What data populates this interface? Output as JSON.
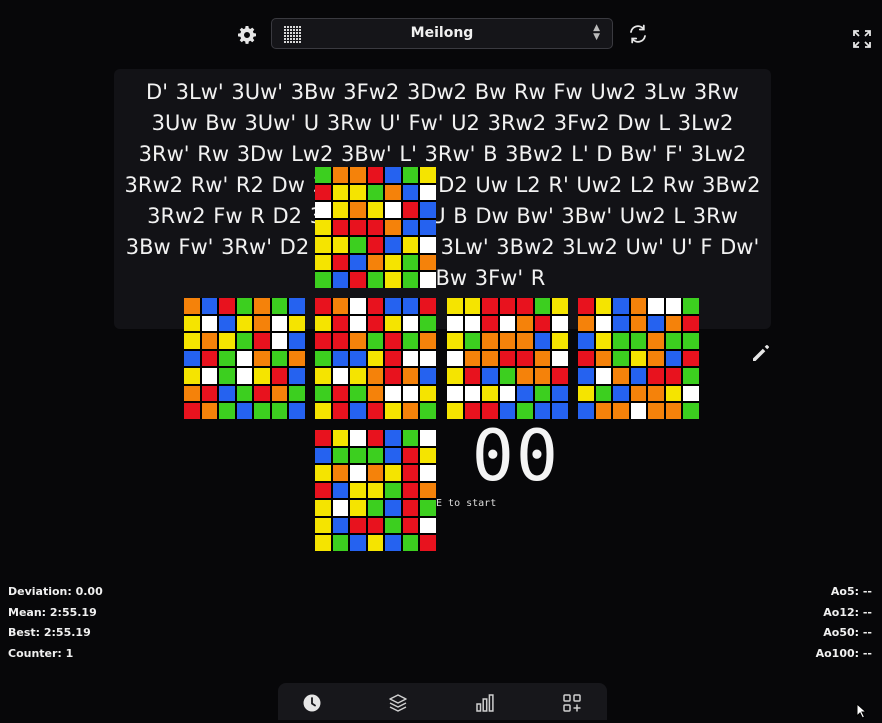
{
  "header": {
    "settings_icon": "gear-icon",
    "puzzle_select": {
      "value": "Meilong",
      "icon": "cube-grid-icon"
    },
    "refresh_icon": "refresh-icon",
    "fullscreen_icon": "fullscreen-icon"
  },
  "scramble": {
    "text": "D' 3Lw' 3Uw' 3Bw 3Fw2 3Dw2 Bw Rw Fw Uw2 3Lw 3Rw 3Uw Bw 3Uw' U 3Rw U' Fw' U2 3Rw2 3Fw2 Dw L 3Lw2 3Rw' Rw 3Dw Lw2 3Bw' L' 3Rw' B 3Bw2 L' D Bw' F' 3Lw2 3Rw2 Rw' R2 Dw 3Lw2 D2 L' D2 Uw L2 R' Uw2 L2 Rw 3Bw2 3Rw2 Fw R D2 3Uw2 Uw2 U B Dw Bw' 3Bw' Uw2 L 3Rw 3Bw Fw' 3Rw' D2 Bw2 L' Uw' 3Lw' 3Bw2 3Lw2 Uw' U' F Dw' Lw' Uw2 Bw 3Fw' R"
  },
  "timer": {
    "display": "00",
    "hint": "CE to start"
  },
  "stats_left": {
    "deviation": "Deviation: 0.00",
    "mean": "Mean: 2:55.19",
    "best": "Best: 2:55.19",
    "counter": "Counter: 1"
  },
  "stats_right": {
    "ao5": "Ao5: --",
    "ao12": "Ao12: --",
    "ao50": "Ao50: --",
    "ao100": "Ao100: --"
  },
  "bottom_nav": [
    "clock-icon",
    "layers-icon",
    "bar-chart-icon",
    "add-widget-icon"
  ],
  "colors": {
    "W": "#ffffff",
    "Y": "#f5e400",
    "R": "#e8121e",
    "O": "#f5820a",
    "G": "#3ccf1f",
    "B": "#2562f0"
  },
  "cube_net": {
    "U": [
      "GOORBGY",
      "RYYGOBW",
      "WYOYWRB",
      "YRRROBB",
      "YYGRBYW",
      "YRBOYGO",
      "GBRGYGW"
    ],
    "L": [
      "OBRGOGB",
      "YWBYOWY",
      "YOYGRWB",
      "BRGWOGO",
      "YWGWYRB",
      "ORBGROG",
      "ROGBGGB"
    ],
    "F": [
      "ROWRBBR",
      "YRWRYWG",
      "RROGRGO",
      "GBBYRWW",
      "YWYOROB",
      "GRGOWWY",
      "YRBRYOG"
    ],
    "R": [
      "YYRRRGY",
      "WWRWORW",
      "YGOOOBY",
      "WOORROW",
      "YRBGOOR",
      "WWYWBGB",
      "YRRBGBB"
    ],
    "B": [
      "RYBOWWG",
      "OWBOBOR",
      "BYGGOGG",
      "ROGYOBR",
      "BWOBRRG",
      "YGBOOYW",
      "BOOWOOG"
    ],
    "D": [
      "RYWRBGW",
      "BGGGBRY",
      "YOWOYRW",
      "RBYYGRO",
      "YWYGBRG",
      "YBRRGRW",
      "YGBYBGR"
    ]
  }
}
